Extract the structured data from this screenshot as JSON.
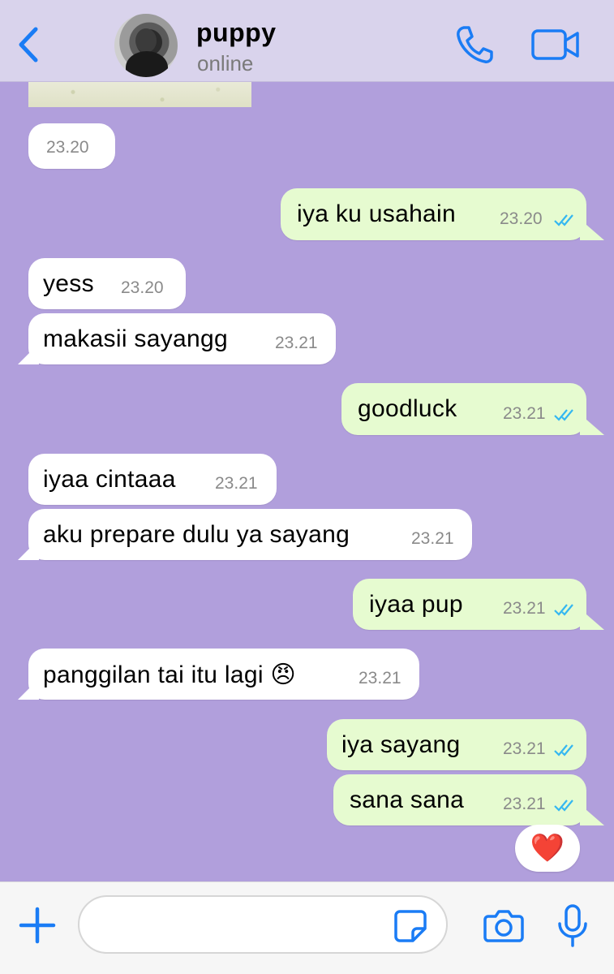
{
  "contact": {
    "name": "puppy",
    "status": "online"
  },
  "date_bubble": {
    "time": "23.20"
  },
  "messages": [
    {
      "dir": "out",
      "text": "iya ku usahain",
      "time": "23.20"
    },
    {
      "dir": "in",
      "text": "yess",
      "time": "23.20"
    },
    {
      "dir": "in",
      "text": "makasii sayangg",
      "time": "23.21"
    },
    {
      "dir": "out",
      "text": "goodluck",
      "time": "23.21"
    },
    {
      "dir": "in",
      "text": "iyaa cintaaa",
      "time": "23.21"
    },
    {
      "dir": "in",
      "text": "aku prepare dulu ya sayang",
      "time": "23.21"
    },
    {
      "dir": "out",
      "text": "iyaa pup",
      "time": "23.21"
    },
    {
      "dir": "in",
      "text": "panggilan tai itu lagi 😠",
      "time": "23.21"
    },
    {
      "dir": "out",
      "text": "iya sayang",
      "time": "23.21"
    },
    {
      "dir": "out",
      "text": "sana sana",
      "time": "23.21"
    }
  ],
  "reaction": {
    "emoji": "❤️"
  },
  "composer": {
    "placeholder": ""
  },
  "colors": {
    "accent": "#1a7cf5",
    "chat_background": "#b19fdc",
    "outgoing_bubble": "#e6fbd0",
    "incoming_bubble": "#ffffff",
    "read_ticks": "#34b7f1"
  },
  "icons": [
    "back-chevron-icon",
    "phone-icon",
    "video-camera-icon",
    "plus-icon",
    "sticker-icon",
    "camera-icon",
    "microphone-icon",
    "double-check-icon"
  ]
}
